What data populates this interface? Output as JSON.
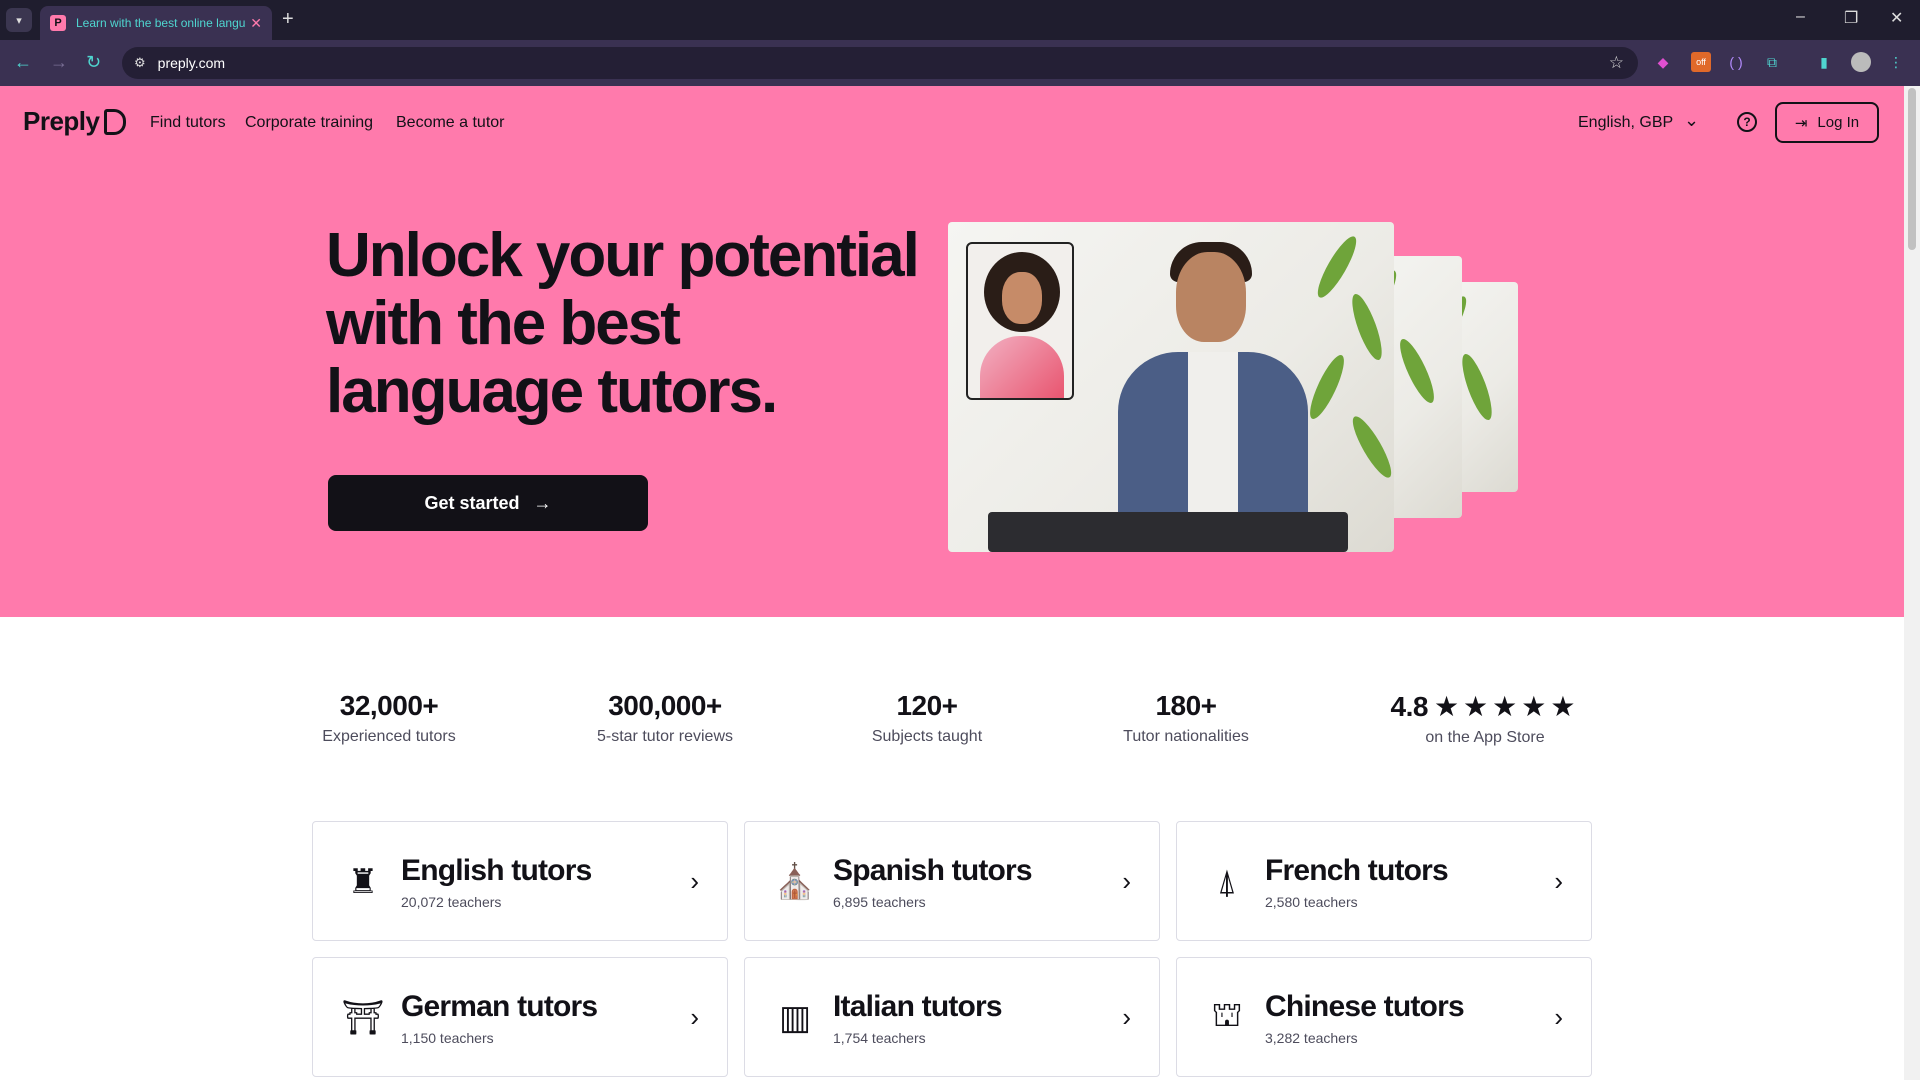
{
  "browser": {
    "tab_title": "Learn with the best online language tutors",
    "tab_close": "✕",
    "new_tab": "+",
    "url": "preply.com",
    "win_min": "–",
    "win_restore": "❐",
    "win_close": "✕"
  },
  "nav": {
    "logo": "Preply",
    "links": [
      "Find tutors",
      "Corporate training",
      "Become a tutor"
    ],
    "language": "English, GBP",
    "help": "?",
    "login": "Log In"
  },
  "hero": {
    "headline": "Unlock your potential with the best language tutors.",
    "cta": "Get started",
    "cta_arrow": "→"
  },
  "stats": [
    {
      "value": "32,000+",
      "label": "Experienced tutors"
    },
    {
      "value": "300,000+",
      "label": "5-star tutor reviews"
    },
    {
      "value": "120+",
      "label": "Subjects taught"
    },
    {
      "value": "180+",
      "label": "Tutor nationalities"
    },
    {
      "value": "4.8",
      "stars": "★★★★★",
      "label": "on the App Store"
    }
  ],
  "subjects": [
    {
      "title": "English tutors",
      "count": "20,072 teachers",
      "icon": "big-ben-icon"
    },
    {
      "title": "Spanish tutors",
      "count": "6,895 teachers",
      "icon": "sagrada-familia-icon"
    },
    {
      "title": "French tutors",
      "count": "2,580 teachers",
      "icon": "eiffel-tower-icon"
    },
    {
      "title": "German tutors",
      "count": "1,150 teachers",
      "icon": "brandenburg-gate-icon"
    },
    {
      "title": "Italian tutors",
      "count": "1,754 teachers",
      "icon": "pisa-tower-icon"
    },
    {
      "title": "Chinese tutors",
      "count": "3,282 teachers",
      "icon": "great-wall-icon"
    }
  ],
  "colors": {
    "hero_bg": "#ff7aac",
    "text": "#121117",
    "browser_bg": "#1f1d2e",
    "browser_toolbar": "#3a3152"
  }
}
